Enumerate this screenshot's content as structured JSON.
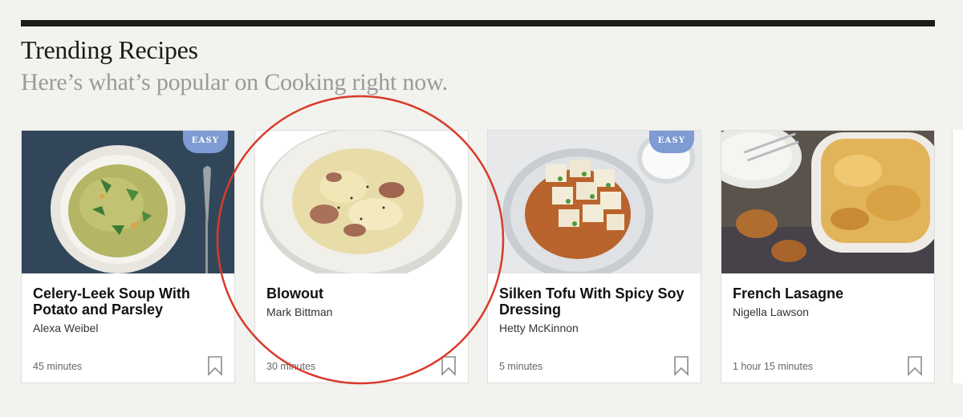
{
  "header": {
    "title": "Trending Recipes",
    "subtitle": "Here’s what’s popular on Cooking right now."
  },
  "cards": [
    {
      "title": "Celery-Leek Soup With Potato and Parsley",
      "author": "Alexa Weibel",
      "time": "45 minutes",
      "badge": "EASY",
      "image": "green-soup-bowl"
    },
    {
      "title": "Blowout",
      "author": "Mark Bittman",
      "time": "30 minutes",
      "badge": "",
      "image": "mashed-potatoes-plate"
    },
    {
      "title": "Silken Tofu With Spicy Soy Dressing",
      "author": "Hetty McKinnon",
      "time": "5 minutes",
      "badge": "EASY",
      "image": "tofu-plate"
    },
    {
      "title": "French Lasagne",
      "author": "Nigella Lawson",
      "time": "1 hour 15 minutes",
      "badge": "",
      "image": "lasagne-dish"
    }
  ],
  "icons": {
    "bookmark": "bookmark-icon"
  },
  "colors": {
    "badge": "#7e9bd3",
    "annotation": "#d93a2b",
    "background": "#f2f2ee"
  }
}
